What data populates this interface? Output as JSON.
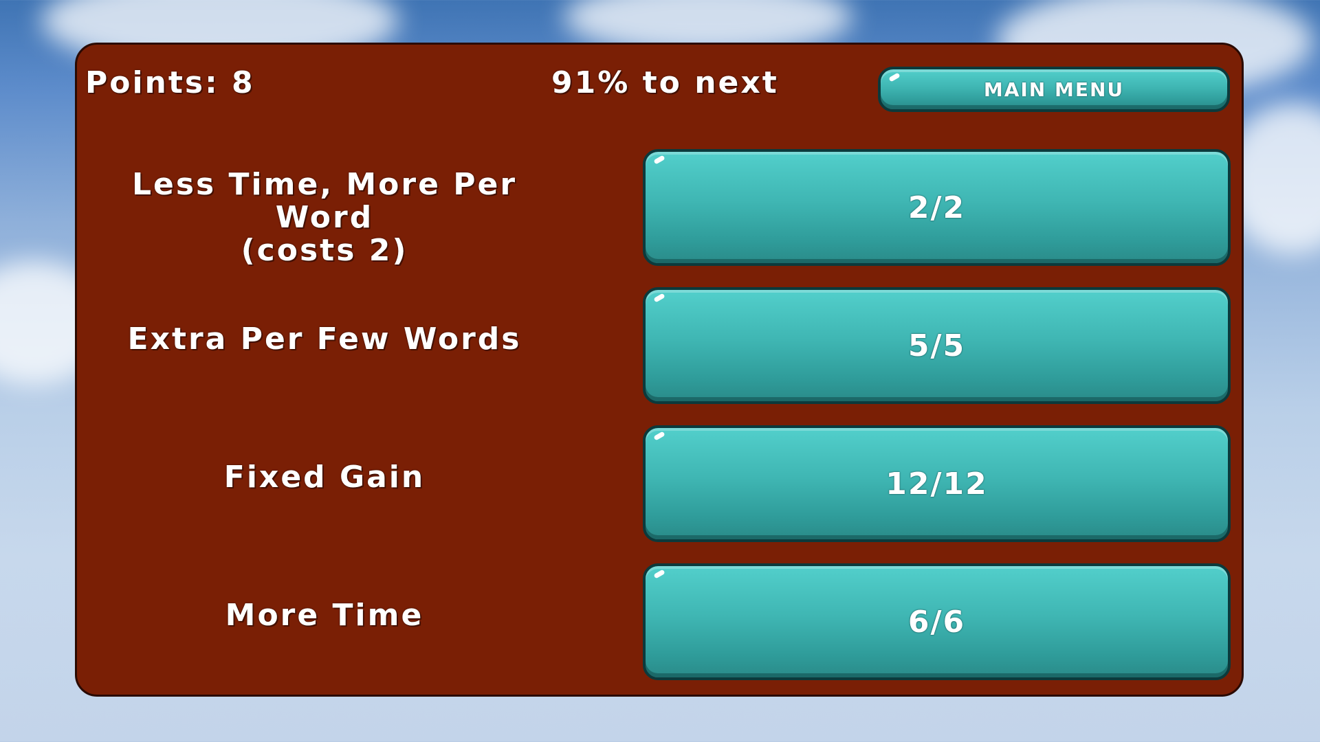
{
  "hud": {
    "points_text": "Points: 8",
    "progress_text": "91% to next",
    "main_menu_label": "MAIN MENU"
  },
  "upgrades": [
    {
      "label": "Less Time, More Per Word\n(costs 2)",
      "level_text": "2/2"
    },
    {
      "label": "Extra Per Few Words",
      "level_text": "5/5"
    },
    {
      "label": "Fixed Gain",
      "level_text": "12/12"
    },
    {
      "label": "More Time",
      "level_text": "6/6"
    }
  ],
  "colors": {
    "panel": "#7a1f05",
    "button": "#3fb6b3",
    "button_border": "#0b3a3c",
    "text": "#ffffff"
  }
}
